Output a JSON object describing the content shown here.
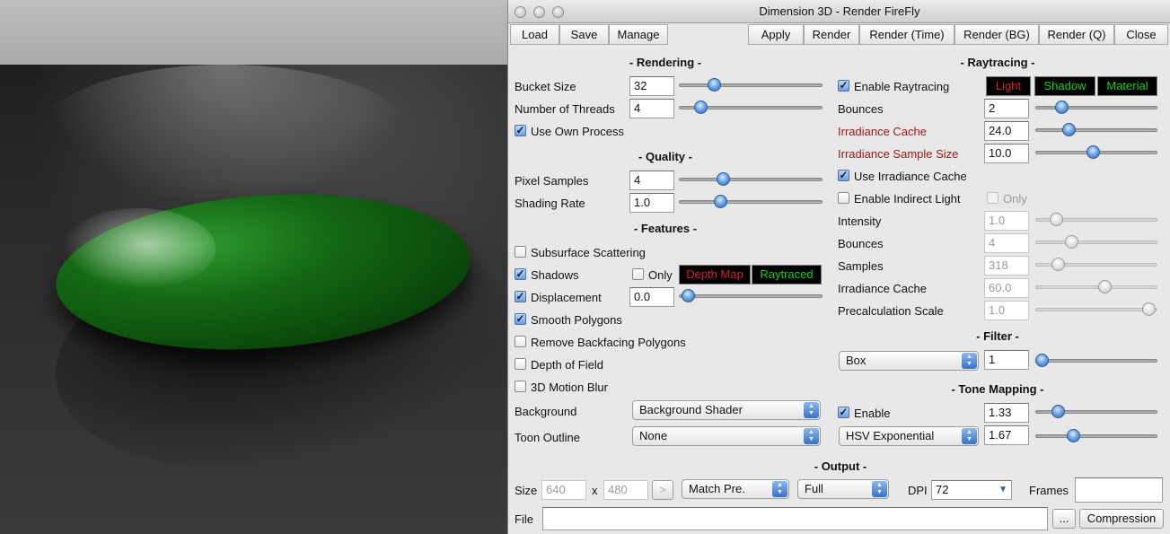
{
  "window": {
    "title": "Dimension 3D - Render FireFly"
  },
  "toolbar": {
    "left": [
      "Load",
      "Save",
      "Manage"
    ],
    "right": [
      "Apply",
      "Render",
      "Render (Time)",
      "Render (BG)",
      "Render (Q)",
      "Close"
    ]
  },
  "rendering": {
    "section": "- Rendering -",
    "bucket_size": {
      "label": "Bucket Size",
      "value": "32",
      "slider": 0.22
    },
    "threads": {
      "label": "Number of Threads",
      "value": "4",
      "slider": 0.12
    },
    "use_own_process": {
      "label": "Use Own Process",
      "checked": true
    }
  },
  "quality": {
    "section": "- Quality -",
    "pixel_samples": {
      "label": "Pixel Samples",
      "value": "4",
      "slider": 0.29
    },
    "shading_rate": {
      "label": "Shading Rate",
      "value": "1.0",
      "slider": 0.27
    }
  },
  "features": {
    "section": "- Features -",
    "subsurface": {
      "label": "Subsurface Scattering",
      "checked": false
    },
    "shadows": {
      "label": "Shadows",
      "checked": true,
      "only_label": "Only",
      "only_checked": false,
      "depth_map": "Depth Map",
      "raytraced": "Raytraced"
    },
    "displacement": {
      "label": "Displacement",
      "checked": true,
      "value": "0.0",
      "slider": 0.02
    },
    "smooth": {
      "label": "Smooth Polygons",
      "checked": true
    },
    "backfacing": {
      "label": "Remove Backfacing Polygons",
      "checked": false
    },
    "dof": {
      "label": "Depth of Field",
      "checked": false
    },
    "motion_blur": {
      "label": "3D Motion Blur",
      "checked": false
    },
    "background": {
      "label": "Background",
      "value": "Background Shader"
    },
    "toon_outline": {
      "label": "Toon Outline",
      "value": "None"
    }
  },
  "raytracing": {
    "section": "- Raytracing -",
    "enable": {
      "label": "Enable Raytracing",
      "checked": true
    },
    "tags": [
      "Light",
      "Shadow",
      "Material"
    ],
    "bounces": {
      "label": "Bounces",
      "value": "2",
      "slider": 0.18
    },
    "irr_cache": {
      "label": "Irradiance Cache",
      "value": "24.0",
      "slider": 0.25
    },
    "irr_sample": {
      "label": "Irradiance Sample Size",
      "value": "10.0",
      "slider": 0.47
    },
    "use_irr_cache": {
      "label": "Use Irradiance Cache",
      "checked": true
    },
    "indirect": {
      "label": "Enable Indirect Light",
      "checked": false,
      "only_label": "Only",
      "only_checked": false
    },
    "intensity": {
      "label": "Intensity",
      "value": "1.0",
      "slider": 0.13
    },
    "ind_bounces": {
      "label": "Bounces",
      "value": "4",
      "slider": 0.27
    },
    "samples": {
      "label": "Samples",
      "value": "318",
      "slider": 0.15
    },
    "ind_irr_cache": {
      "label": "Irradiance Cache",
      "value": "60.0",
      "slider": 0.58
    },
    "precalc": {
      "label": "Precalculation Scale",
      "value": "1.0",
      "slider": 0.98
    }
  },
  "filter": {
    "section": "- Filter -",
    "type": "Box",
    "value": "1",
    "slider": 0.0
  },
  "tone_mapping": {
    "section": "- Tone Mapping -",
    "enable": {
      "label": "Enable",
      "checked": true
    },
    "value1": "1.33",
    "slider1": 0.15,
    "method": "HSV Exponential",
    "value2": "1.67",
    "slider2": 0.29
  },
  "output": {
    "section": "- Output -",
    "size_label": "Size",
    "width": "640",
    "x_label": "x",
    "height": "480",
    "arrow": ">",
    "match": "Match Pre.",
    "full": "Full",
    "dpi_label": "DPI",
    "dpi": "72",
    "frames_label": "Frames",
    "frames": "",
    "file_label": "File",
    "file": "",
    "browse": "...",
    "compression": "Compression"
  }
}
